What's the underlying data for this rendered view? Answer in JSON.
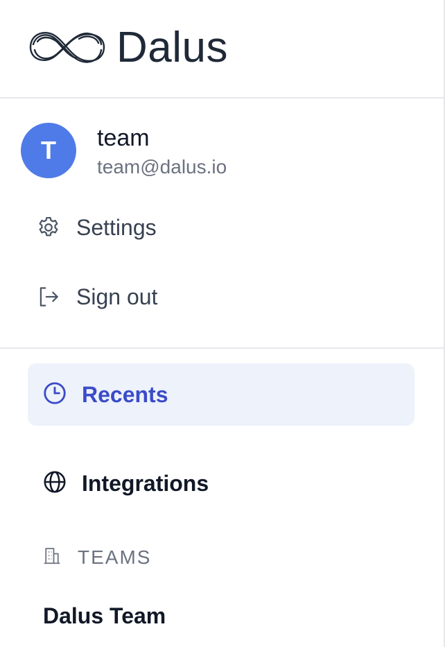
{
  "brand": {
    "name": "Dalus",
    "logo_icon": "dalus-wave-logo-icon"
  },
  "user": {
    "avatar_initial": "T",
    "avatar_color": "#4f7be8",
    "name": "team",
    "email": "team@dalus.io"
  },
  "account_menu": {
    "settings_label": "Settings",
    "settings_icon": "gear-icon",
    "signout_label": "Sign out",
    "signout_icon": "sign-out-icon"
  },
  "nav": {
    "recents_label": "Recents",
    "recents_icon": "clock-icon",
    "recents_active": true,
    "integrations_label": "Integrations",
    "integrations_icon": "globe-icon"
  },
  "teams": {
    "header_label": "TEAMS",
    "header_icon": "building-icon",
    "items": [
      "Dalus Team"
    ]
  },
  "colors": {
    "accent": "#3b4bc8",
    "active_bg": "#edf2fb"
  }
}
